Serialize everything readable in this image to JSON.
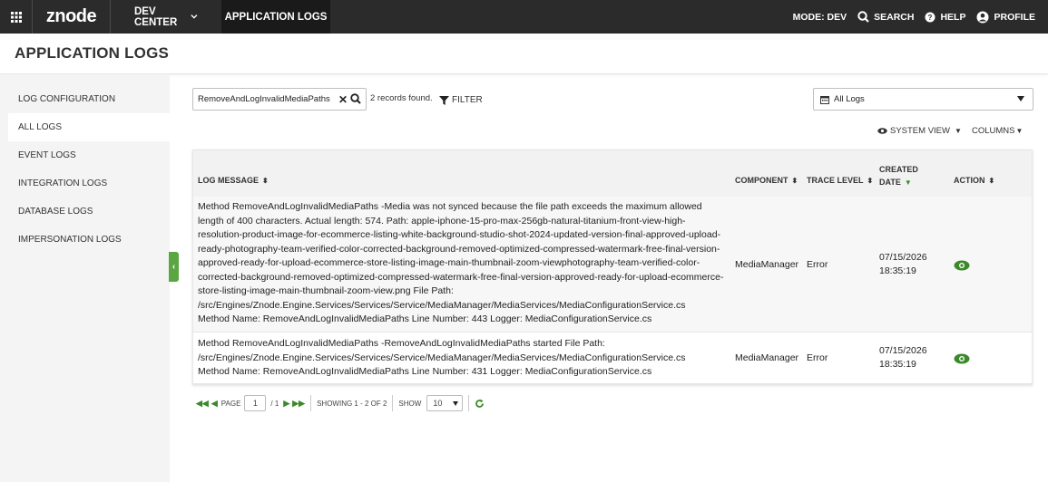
{
  "topbar": {
    "logo": "znode",
    "menu_dev_center": "DEV CENTER",
    "menu_app_logs": "APPLICATION LOGS",
    "mode": "MODE: DEV",
    "search": "SEARCH",
    "help": "HELP",
    "profile": "PROFILE"
  },
  "page": {
    "title": "APPLICATION LOGS"
  },
  "sidebar": {
    "items": [
      {
        "label": "LOG CONFIGURATION"
      },
      {
        "label": "ALL LOGS"
      },
      {
        "label": "EVENT LOGS"
      },
      {
        "label": "INTEGRATION LOGS"
      },
      {
        "label": "DATABASE LOGS"
      },
      {
        "label": "IMPERSONATION LOGS"
      }
    ]
  },
  "toolbar": {
    "search_value": "RemoveAndLogInvalidMediaPaths",
    "records_found": "2 records found.",
    "filter_label": "FILTER",
    "log_select": "All Logs",
    "system_view": "SYSTEM VIEW",
    "columns": "COLUMNS"
  },
  "table": {
    "headers": {
      "log_message": "LOG MESSAGE",
      "component": "COMPONENT",
      "trace_level": "TRACE LEVEL",
      "created": "CREATED",
      "date": "DATE",
      "action": "ACTION"
    },
    "rows": [
      {
        "lines": [
          "Method RemoveAndLogInvalidMediaPaths -Media was not synced because the file path exceeds the maximum allowed",
          "length of 400 characters. Actual length: 574. Path: apple-iphone-15-pro-max-256gb-natural-titanium-front-view-high-",
          "resolution-product-image-for-ecommerce-listing-white-background-studio-shot-2024-updated-version-final-approved-upload-",
          "ready-photography-team-verified-color-corrected-background-removed-optimized-compressed-watermark-free-final-version-",
          "approved-ready-for-upload-ecommerce-store-listing-image-main-thumbnail-zoom-viewphotography-team-verified-color-",
          "corrected-background-removed-optimized-compressed-watermark-free-final-version-approved-ready-for-upload-ecommerce-",
          "store-listing-image-main-thumbnail-zoom-view.png File Path:",
          "/src/Engines/Znode.Engine.Services/Services/Service/MediaManager/MediaServices/MediaConfigurationService.cs",
          "Method Name: RemoveAndLogInvalidMediaPaths Line Number: 443 Logger: MediaConfigurationService.cs"
        ],
        "component": "MediaManager",
        "trace_level": "Error",
        "date": "07/15/2026",
        "time": "18:35:19"
      },
      {
        "lines": [
          "Method RemoveAndLogInvalidMediaPaths -RemoveAndLogInvalidMediaPaths started File Path:",
          "/src/Engines/Znode.Engine.Services/Services/Service/MediaManager/MediaServices/MediaConfigurationService.cs",
          "Method Name: RemoveAndLogInvalidMediaPaths Line Number: 431 Logger: MediaConfigurationService.cs"
        ],
        "component": "MediaManager",
        "trace_level": "Error",
        "date": "07/15/2026",
        "time": "18:35:19"
      }
    ]
  },
  "pager": {
    "page_label": "PAGE",
    "page": "1",
    "total": "/ 1",
    "showing": "SHOWING 1 - 2 OF 2",
    "show_label": "SHOW",
    "page_size": "10"
  },
  "colors": {
    "accent": "#3a8a2a",
    "topbar": "#2b2b2b"
  }
}
